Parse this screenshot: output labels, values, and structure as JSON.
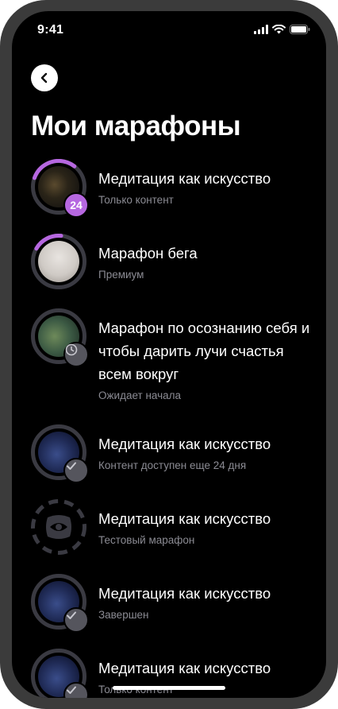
{
  "status_bar": {
    "time": "9:41"
  },
  "header": {
    "title": "Мои марафоны"
  },
  "colors": {
    "accent": "#b667e0",
    "ring": "#3a3a42",
    "subtitle": "#8b8b93",
    "badge_grey": "#55555d"
  },
  "marathons": [
    {
      "name": "Медитация как искусство",
      "subtitle": "Только контент",
      "badge": "24",
      "progress": 0.3
    },
    {
      "name": "Марафон бега",
      "subtitle": "Премиум",
      "progress": 0.18
    },
    {
      "name": "Марафон по осознанию себя и чтобы дарить лучи счастья всем вокруг",
      "subtitle": "Ожидает начала",
      "badge_icon": "clock-icon"
    },
    {
      "name": "Медитация как искусство",
      "subtitle": "Контент доступен еще 24 дня",
      "badge_icon": "check-icon"
    },
    {
      "name": "Медитация как искусство",
      "subtitle": "Тестовый марафон",
      "icon": "eye-icon"
    },
    {
      "name": "Медитация как искусство",
      "subtitle": "Завершен",
      "badge_icon": "check-icon"
    },
    {
      "name": "Медитация как искусство",
      "subtitle": "Только контент",
      "badge_icon": "check-icon"
    }
  ]
}
